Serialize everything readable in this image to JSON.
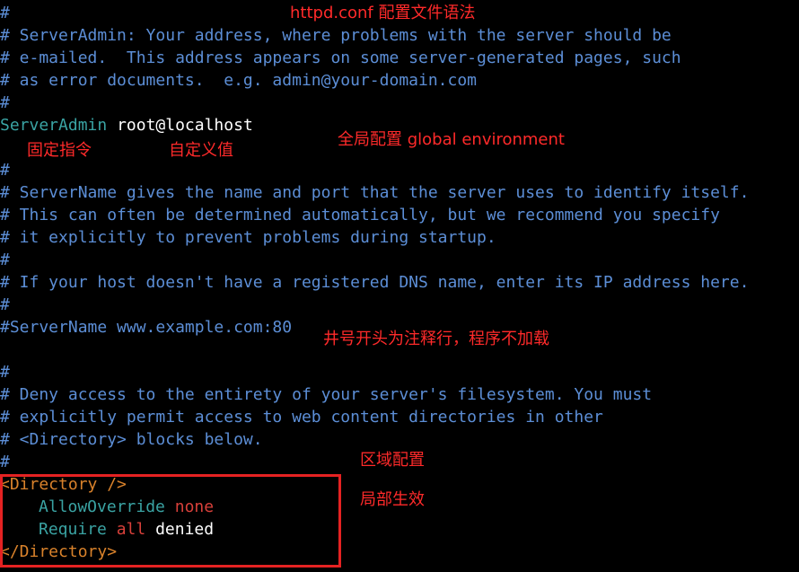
{
  "colors": {
    "background": "#000000",
    "comment": "#5c8ed6",
    "directive": "#3aa3a3",
    "value": "#ffffff",
    "tag": "#d9822b",
    "keyword": "#d8403a",
    "annotation": "#ff2a2a"
  },
  "code": {
    "l0": "#",
    "l1": "# ServerAdmin: Your address, where problems with the server should be",
    "l2": "# e-mailed.  This address appears on some server-generated pages, such",
    "l3": "# as error documents.  e.g. admin@your-domain.com",
    "l4": "#",
    "l5_directive": "ServerAdmin",
    "l5_value": "root@localhost",
    "l7": "#",
    "l8": "# ServerName gives the name and port that the server uses to identify itself.",
    "l9": "# This can often be determined automatically, but we recommend you specify",
    "l10": "# it explicitly to prevent problems during startup.",
    "l11": "#",
    "l12": "# If your host doesn't have a registered DNS name, enter its IP address here.",
    "l13": "#",
    "l14": "#ServerName www.example.com:80",
    "l16": "#",
    "l17": "# Deny access to the entirety of your server's filesystem. You must",
    "l18": "# explicitly permit access to web content directories in other",
    "l19": "# <Directory> blocks below.",
    "l20": "#",
    "l21_tag": "<Directory />",
    "l22_directive": "AllowOverride",
    "l22_value": "none",
    "l23_directive": "Require",
    "l23_kw": "all",
    "l23_value": "denied",
    "l24_tag": "</Directory>"
  },
  "annotations": {
    "title": "httpd.conf 配置文件语法",
    "fixed_directive": "固定指令",
    "custom_value": "自定义值",
    "global": "全局配置  global environment",
    "comment_note": "井号开头为注释行，程序不加载",
    "section": "区域配置",
    "local": "局部生效"
  }
}
